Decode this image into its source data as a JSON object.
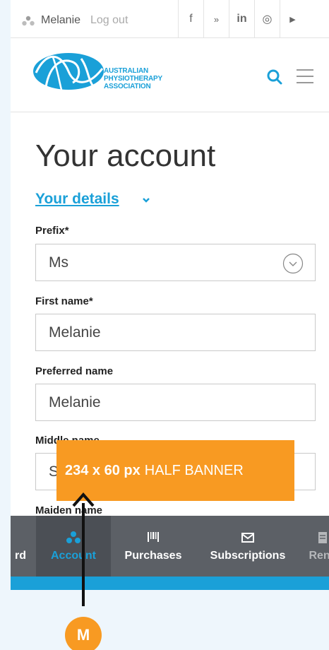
{
  "topbar": {
    "user_name": "Melanie",
    "logout_label": "Log out",
    "social": [
      "f",
      "»",
      "in",
      "◎",
      "▶"
    ]
  },
  "header": {
    "logo_lines": [
      "AUSTRALIAN",
      "PHYSIOTHERAPY",
      "ASSOCIATION"
    ]
  },
  "page": {
    "title": "Your account",
    "section": "Your details"
  },
  "form": {
    "prefix_label": "Prefix*",
    "prefix_value": "Ms",
    "first_name_label": "First name*",
    "first_name_value": "Melanie",
    "preferred_name_label": "Preferred name",
    "preferred_name_value": "Melanie",
    "middle_name_label": "Middle name",
    "middle_name_value": "S",
    "maiden_name_label": "Maiden name"
  },
  "banner": {
    "size": "234 x 60 px",
    "kind": "HALF BANNER"
  },
  "bottom_nav": {
    "items": [
      "rd",
      "Account",
      "Purchases",
      "Subscriptions",
      "Rene"
    ]
  },
  "marker": {
    "label": "M"
  },
  "colors": {
    "accent": "#1aa0d8",
    "banner": "#f89a22",
    "nav_bg": "#5c6066"
  }
}
